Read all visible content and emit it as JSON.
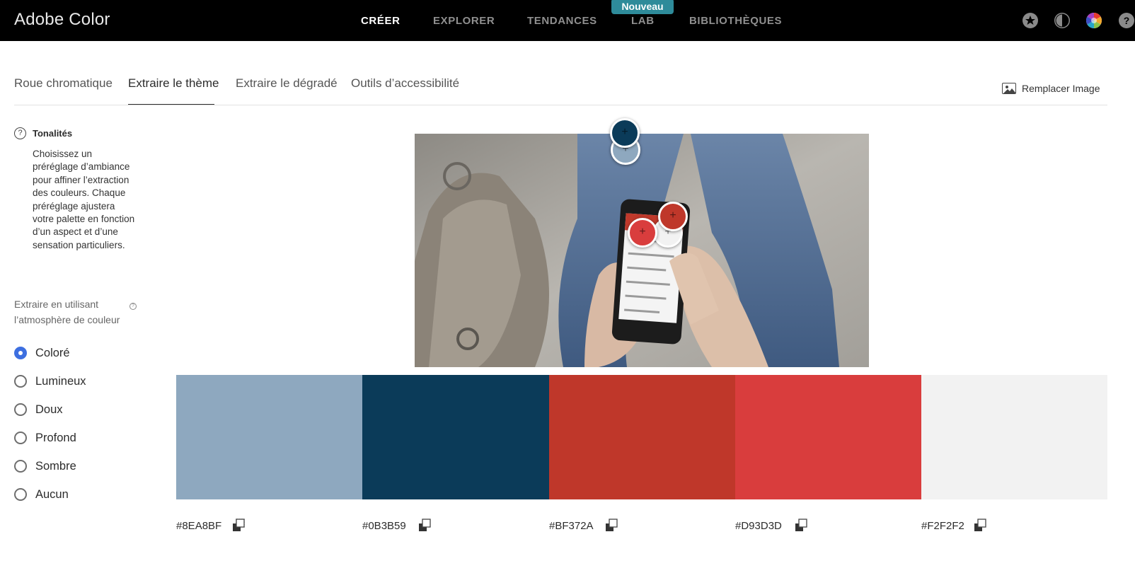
{
  "header": {
    "brand": "Adobe Color",
    "nav": [
      {
        "label": "CRÉER",
        "active": true
      },
      {
        "label": "EXPLORER",
        "active": false
      },
      {
        "label": "TENDANCES",
        "active": false
      },
      {
        "label": "LAB",
        "active": false
      },
      {
        "label": "BIBLIOTHÈQUES",
        "active": false
      }
    ],
    "badge": "Nouveau",
    "icons": [
      "star-icon",
      "contrast-icon",
      "color-wheel-icon",
      "help-icon"
    ]
  },
  "tabs": [
    {
      "label": "Roue chromatique",
      "active": false
    },
    {
      "label": "Extraire le thème",
      "active": true
    },
    {
      "label": "Extraire le dégradé",
      "active": false
    },
    {
      "label": "Outils d’accessibilité",
      "active": false
    }
  ],
  "replace_image": {
    "label": "Remplacer Image",
    "icon": "image-icon"
  },
  "sidebar": {
    "tonal_title": "Tonalités",
    "tonal_description": "Choisissez un préréglage d’ambiance pour affiner l’extraction des couleurs. Chaque préréglage ajustera votre palette en fonction d’un aspect et d’une sensation particuliers.",
    "extract_label": "Extraire en utilisant l’atmosphère de couleur",
    "moods": [
      {
        "label": "Coloré",
        "checked": true
      },
      {
        "label": "Lumineux",
        "checked": false
      },
      {
        "label": "Doux",
        "checked": false
      },
      {
        "label": "Profond",
        "checked": false
      },
      {
        "label": "Sombre",
        "checked": false
      },
      {
        "label": "Aucun",
        "checked": false
      }
    ]
  },
  "palette": [
    {
      "hex": "#8EA8BF",
      "label": "#8EA8BF"
    },
    {
      "hex": "#0B3B59",
      "label": "#0B3B59"
    },
    {
      "hex": "#BF372A",
      "label": "#BF372A"
    },
    {
      "hex": "#D93D3D",
      "label": "#D93D3D"
    },
    {
      "hex": "#F2F2F2",
      "label": "#F2F2F2"
    }
  ],
  "colors": {
    "accent_radio": "#3d6fe0",
    "badge_bg": "#2e8b9a",
    "topbar_bg": "#000000"
  }
}
